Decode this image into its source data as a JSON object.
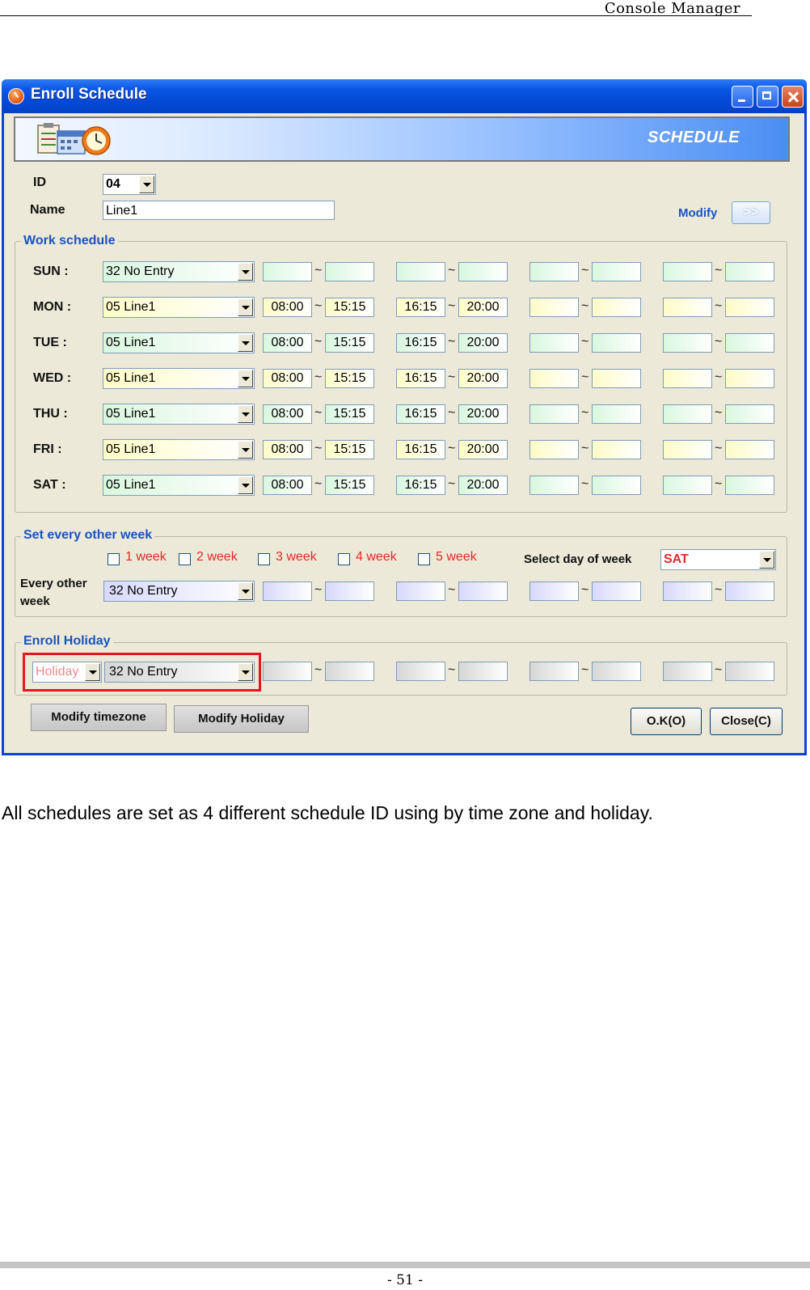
{
  "document": {
    "header_title": "Console Manager",
    "caption": "All schedules are set as 4 different schedule ID using by time zone and holiday.",
    "page_number": "- 51 -"
  },
  "window": {
    "title": "Enroll Schedule",
    "banner_text": "SCHEDULE"
  },
  "form": {
    "id_label": "ID",
    "id_value": "04",
    "name_label": "Name",
    "name_value": "Line1",
    "modify_label": "Modify",
    "modify_button": ">>"
  },
  "work_schedule": {
    "title": "Work schedule",
    "tilde": "~",
    "days": [
      {
        "label": "SUN :",
        "zone": "32 No Entry",
        "color": "green",
        "times": [
          "",
          "",
          "",
          "",
          "",
          "",
          "",
          ""
        ]
      },
      {
        "label": "MON :",
        "zone": "05 Line1",
        "color": "yellow",
        "times": [
          "08:00",
          "15:15",
          "16:15",
          "20:00",
          "",
          "",
          "",
          ""
        ]
      },
      {
        "label": "TUE :",
        "zone": "05 Line1",
        "color": "green",
        "times": [
          "08:00",
          "15:15",
          "16:15",
          "20:00",
          "",
          "",
          "",
          ""
        ]
      },
      {
        "label": "WED :",
        "zone": "05 Line1",
        "color": "yellow",
        "times": [
          "08:00",
          "15:15",
          "16:15",
          "20:00",
          "",
          "",
          "",
          ""
        ]
      },
      {
        "label": "THU :",
        "zone": "05 Line1",
        "color": "green",
        "times": [
          "08:00",
          "15:15",
          "16:15",
          "20:00",
          "",
          "",
          "",
          ""
        ]
      },
      {
        "label": "FRI :",
        "zone": "05 Line1",
        "color": "yellow",
        "times": [
          "08:00",
          "15:15",
          "16:15",
          "20:00",
          "",
          "",
          "",
          ""
        ]
      },
      {
        "label": "SAT :",
        "zone": "05 Line1",
        "color": "green",
        "times": [
          "08:00",
          "15:15",
          "16:15",
          "20:00",
          "",
          "",
          "",
          ""
        ]
      }
    ]
  },
  "other_week": {
    "title": "Set every other week",
    "weeks": [
      "1 week",
      "2 week",
      "3 week",
      "4 week",
      "5 week"
    ],
    "select_day_label": "Select day of week",
    "select_day_value": "SAT",
    "every_other_label_1": "Every other",
    "every_other_label_2": "week",
    "zone": "32 No Entry"
  },
  "holiday": {
    "title": "Enroll Holiday",
    "holiday_value": "Holiday",
    "zone": "32 No Entry"
  },
  "buttons": {
    "modify_timezone": "Modify timezone",
    "modify_holiday": "Modify Holiday",
    "ok": "O.K(O)",
    "close": "Close(C)"
  },
  "colors": {
    "title_bar": "#0a56e4",
    "section_title": "#1853c4",
    "highlight": "#e8161c",
    "week_label": "#e8262a"
  }
}
